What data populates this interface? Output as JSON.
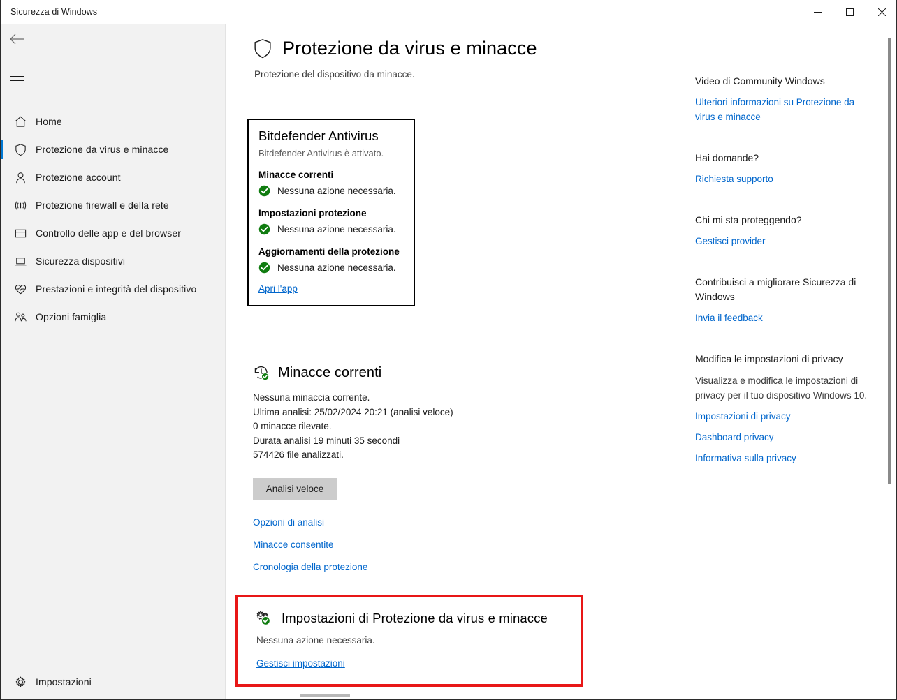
{
  "window": {
    "title": "Sicurezza di Windows",
    "minimize_label": "Riduci a icona",
    "maximize_label": "Ingrandisci",
    "close_label": "Chiudi"
  },
  "sidebar": {
    "back_label": "Indietro",
    "menu_label": "Apri spostamento",
    "items": [
      {
        "label": "Home",
        "icon": "home-icon",
        "active": false
      },
      {
        "label": "Protezione da virus e minacce",
        "icon": "shield-icon",
        "active": true
      },
      {
        "label": "Protezione account",
        "icon": "person-icon",
        "active": false
      },
      {
        "label": "Protezione firewall e della rete",
        "icon": "wifi-icon",
        "active": false
      },
      {
        "label": "Controllo delle app e del browser",
        "icon": "window-icon",
        "active": false
      },
      {
        "label": "Sicurezza dispositivi",
        "icon": "laptop-icon",
        "active": false
      },
      {
        "label": "Prestazioni e integrità del dispositivo",
        "icon": "heart-icon",
        "active": false
      },
      {
        "label": "Opzioni famiglia",
        "icon": "family-icon",
        "active": false
      }
    ],
    "bottom_item": {
      "label": "Impostazioni",
      "icon": "gear-icon"
    }
  },
  "page": {
    "title": "Protezione da virus e minacce",
    "title_icon": "shield-icon",
    "subtitle": "Protezione del dispositivo da minacce."
  },
  "antivirus_card": {
    "title": "Bitdefender Antivirus",
    "subtitle": "Bitdefender Antivirus è attivato.",
    "groups": [
      {
        "heading": "Minacce correnti",
        "status": "Nessuna azione necessaria.",
        "status_icon": "check-circle-icon"
      },
      {
        "heading": "Impostazioni protezione",
        "status": "Nessuna azione necessaria.",
        "status_icon": "check-circle-icon"
      },
      {
        "heading": "Aggiornamenti della protezione",
        "status": "Nessuna azione necessaria.",
        "status_icon": "check-circle-icon"
      }
    ],
    "link": "Apri l'app",
    "border_color": "#000000"
  },
  "threats": {
    "title": "Minacce correnti",
    "title_icon": "history-check-icon",
    "lines": [
      "Nessuna minaccia corrente.",
      "Ultima analisi: 25/02/2024 20:21 (analisi veloce)",
      "0 minacce rilevate.",
      "Durata analisi 19 minuti 35 secondi",
      "574426 file analizzati."
    ],
    "scan_button": "Analisi veloce",
    "links": [
      "Opzioni di analisi",
      "Minacce consentite",
      "Cronologia della protezione"
    ]
  },
  "settings_card": {
    "title": "Impostazioni di Protezione da virus e minacce",
    "title_icon": "gears-check-icon",
    "subtitle": "Nessuna azione necessaria.",
    "link": "Gestisci impostazioni",
    "highlight_color": "#e81717"
  },
  "rail": {
    "blocks": [
      {
        "heading": "Video di Community Windows",
        "paragraph": "",
        "links": [
          "Ulteriori informazioni su Protezione da virus e minacce"
        ]
      },
      {
        "heading": "Hai domande?",
        "paragraph": "",
        "links": [
          "Richiesta supporto"
        ]
      },
      {
        "heading": "Chi mi sta proteggendo?",
        "paragraph": "",
        "links": [
          "Gestisci provider"
        ]
      },
      {
        "heading": "Contribuisci a migliorare Sicurezza di Windows",
        "paragraph": "",
        "links": [
          "Invia il feedback"
        ]
      },
      {
        "heading": "Modifica le impostazioni di privacy",
        "paragraph": "Visualizza e modifica le impostazioni di privacy per il tuo dispositivo Windows 10.",
        "links": [
          "Impostazioni di privacy",
          "Dashboard privacy",
          "Informativa sulla privacy"
        ]
      }
    ]
  },
  "colors": {
    "accent": "#0078d4",
    "link": "#0066cc",
    "success": "#107c10",
    "highlight": "#e81717",
    "sidebar_bg": "#f2f2f2"
  }
}
